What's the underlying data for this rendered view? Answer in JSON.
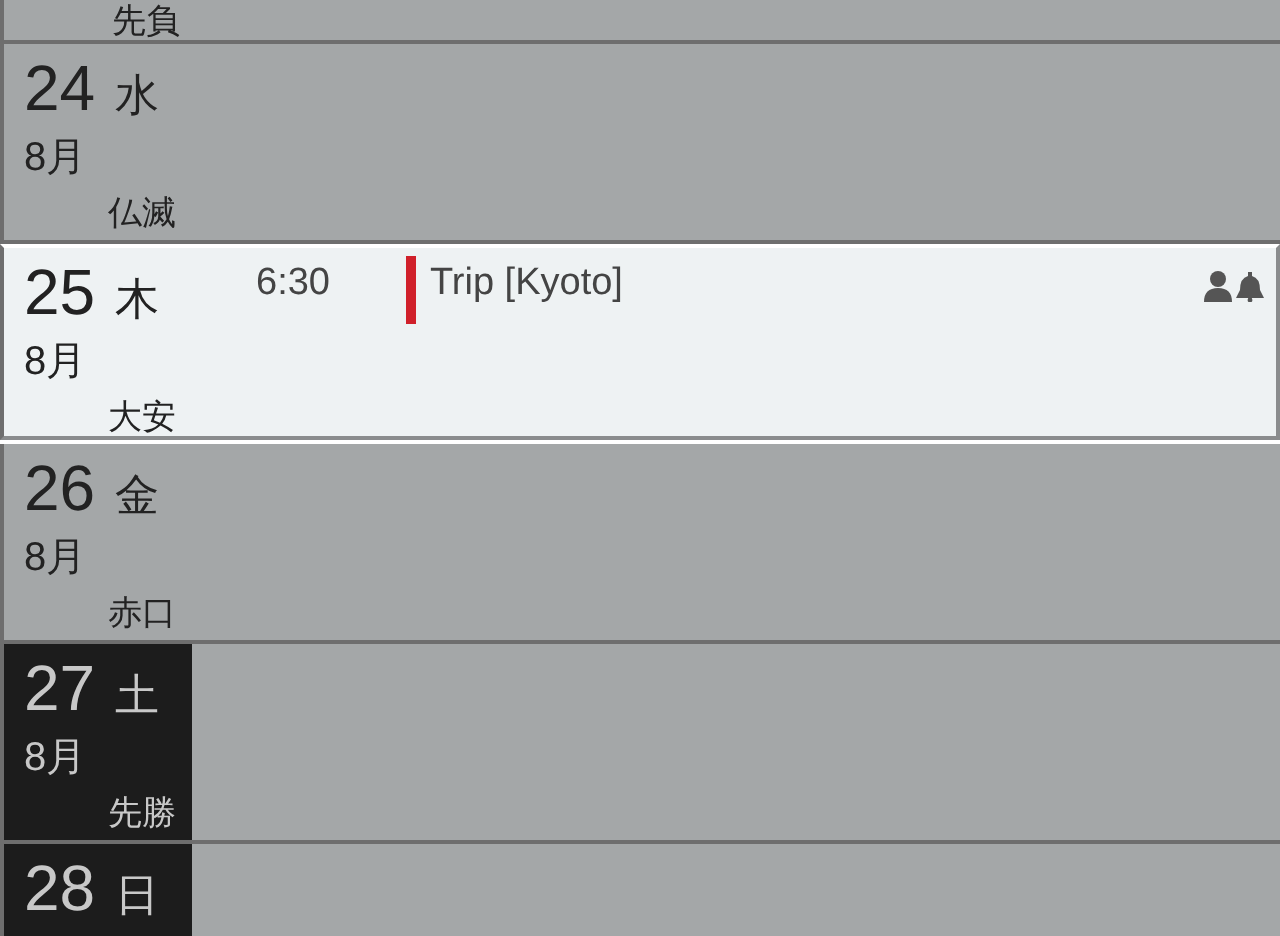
{
  "top_partial_day": {
    "rokuyo": "先負"
  },
  "days": [
    {
      "date": "24",
      "weekday": "水",
      "month": "8月",
      "rokuyo": "仏滅",
      "selected": false,
      "weekend": false
    },
    {
      "date": "25",
      "weekday": "木",
      "month": "8月",
      "rokuyo": "大安",
      "selected": true,
      "weekend": false,
      "events": [
        {
          "time": "6:30",
          "title": "Trip [Kyoto]",
          "color": "#d0202a",
          "shared": true,
          "alarm": true
        }
      ]
    },
    {
      "date": "26",
      "weekday": "金",
      "month": "8月",
      "rokuyo": "赤口",
      "selected": false,
      "weekend": false
    },
    {
      "date": "27",
      "weekday": "土",
      "month": "8月",
      "rokuyo": "先勝",
      "selected": false,
      "weekend": true
    },
    {
      "date": "28",
      "weekday": "日",
      "selected": false,
      "weekend": true
    }
  ]
}
